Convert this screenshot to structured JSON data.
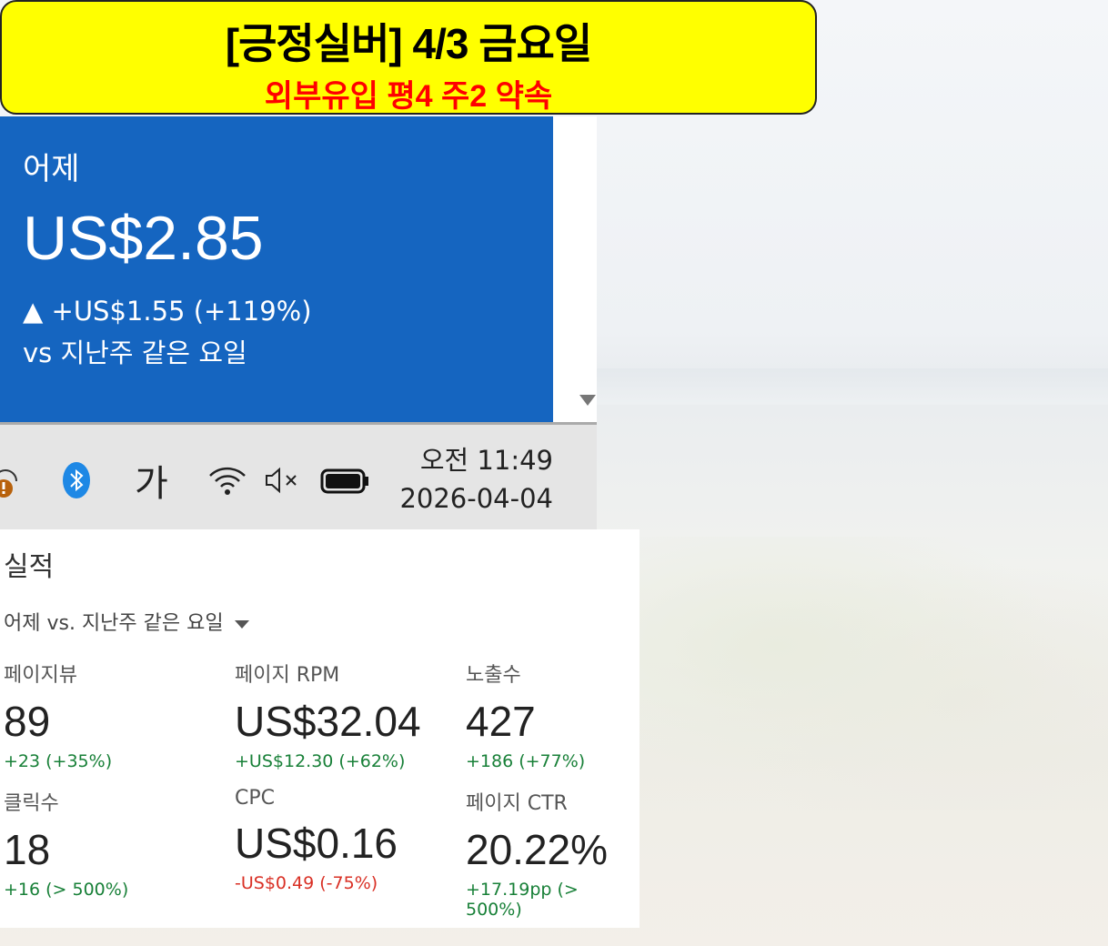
{
  "banner": {
    "title": "[긍정실버] 4/3 금요일",
    "subtitle": "외부유입 평4 주2 약속"
  },
  "card": {
    "label": "어제",
    "amount": "US$2.85",
    "change": "▲ +US$1.55 (+119%)",
    "comparison": "vs 지난주 같은 요일"
  },
  "taskbar": {
    "ime": "가",
    "time": "오전 11:49",
    "date": "2026-04-04"
  },
  "performance": {
    "title": "실적",
    "dropdown": "어제 vs. 지난주 같은 요일",
    "metrics": [
      {
        "name": "페이지뷰",
        "value": "89",
        "delta": "+23 (+35%)",
        "trend": "up"
      },
      {
        "name": "페이지 RPM",
        "value": "US$32.04",
        "delta": "+US$12.30 (+62%)",
        "trend": "up"
      },
      {
        "name": "노출수",
        "value": "427",
        "delta": "+186 (+77%)",
        "trend": "up"
      },
      {
        "name": "클릭수",
        "value": "18",
        "delta": "+16 (> 500%)",
        "trend": "up"
      },
      {
        "name": "CPC",
        "value": "US$0.16",
        "delta": "-US$0.49 (-75%)",
        "trend": "down"
      },
      {
        "name": "페이지 CTR",
        "value": "20.22%",
        "delta": "+17.19pp (> 500%)",
        "trend": "up"
      }
    ]
  },
  "colors": {
    "card": "#1565c0",
    "banner": "#ffff00",
    "positive": "#188038",
    "negative": "#d93025"
  }
}
